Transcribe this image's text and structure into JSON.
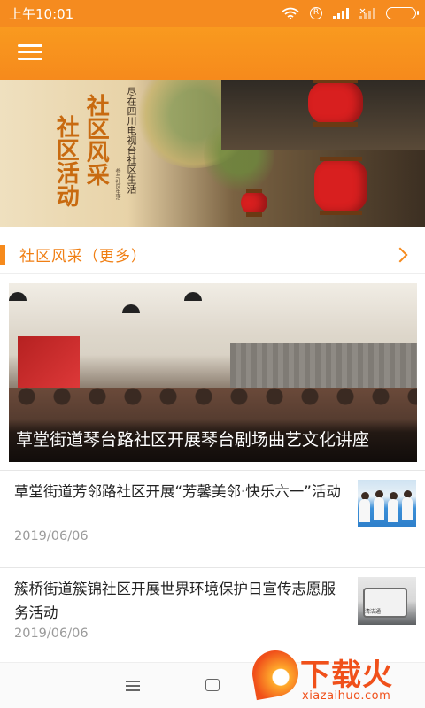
{
  "status_bar": {
    "time": "上午10:01",
    "icons": [
      "wifi-icon",
      "r-badge-icon",
      "signal-icon",
      "no-signal-icon",
      "battery-icon"
    ],
    "r_badge": "R"
  },
  "app_bar": {
    "menu_icon": "hamburger-menu-icon",
    "background": "#f68a1c"
  },
  "banner": {
    "title_line1": "社区风采",
    "title_line2": "社区活动",
    "subtitle": "尽在四川电视台社区生活",
    "tiny": "参与社区生活"
  },
  "section": {
    "title": "社区风采（更多）",
    "more_icon": "chevron-right-icon",
    "accent": "#f68a1c"
  },
  "featured": {
    "caption": "草堂街道琴台路社区开展琴台剧场曲艺文化讲座"
  },
  "news": [
    {
      "title": "草堂街道芳邻路社区开展“芳馨美邻·快乐六一”活动",
      "date": "2019/06/06"
    },
    {
      "title": "簇桥街道簇锦社区开展世界环境保护日宣传志愿服务活动",
      "date": "2019/06/06",
      "thumb_text": "清洁通"
    }
  ],
  "nav_bar": {
    "icons": [
      "recent-apps-icon",
      "home-icon"
    ]
  },
  "watermark": {
    "name": "下载火",
    "url": "xiazaihuo.com"
  }
}
